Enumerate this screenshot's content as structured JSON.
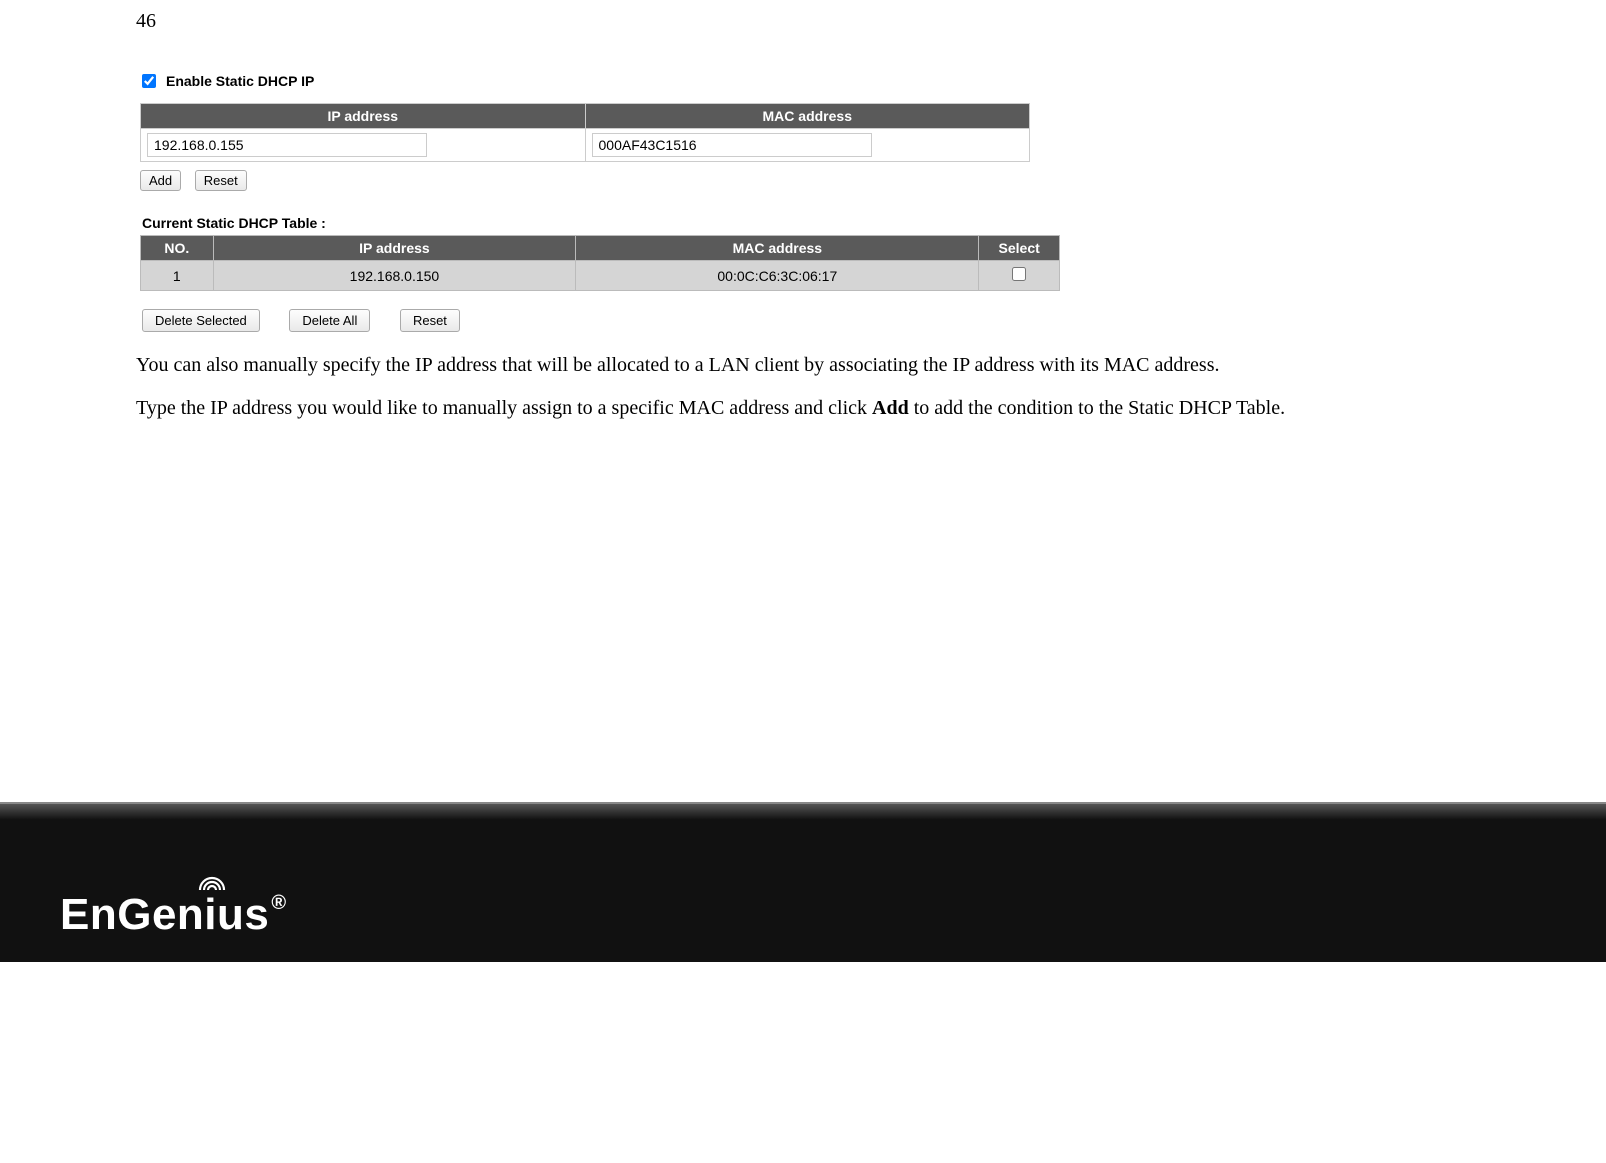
{
  "page_number": "46",
  "enable_checkbox": {
    "checked": true,
    "label": "Enable Static DHCP IP"
  },
  "entry_table": {
    "headers": {
      "ip": "IP address",
      "mac": "MAC address"
    },
    "ip_value": "192.168.0.155",
    "mac_value": "000AF43C1516"
  },
  "buttons": {
    "add": "Add",
    "reset": "Reset"
  },
  "current_table": {
    "heading": "Current Static DHCP Table :",
    "headers": {
      "no": "NO.",
      "ip": "IP address",
      "mac": "MAC address",
      "select": "Select"
    },
    "rows": [
      {
        "no": "1",
        "ip": "192.168.0.150",
        "mac": "00:0C:C6:3C:06:17",
        "selected": false
      }
    ]
  },
  "action_buttons": {
    "delete_selected": "Delete Selected",
    "delete_all": "Delete All",
    "reset": "Reset"
  },
  "body_text": {
    "p1": "You can also manually specify the IP address that will be allocated to a LAN client by associating the IP address with its MAC address.",
    "p2_a": "Type the IP address you would like to manually assign to a specific MAC address and click ",
    "p2_b": "Add",
    "p2_c": " to add the condition to the Static DHCP Table."
  },
  "brand": "EnGenius",
  "brand_trademark": "®"
}
